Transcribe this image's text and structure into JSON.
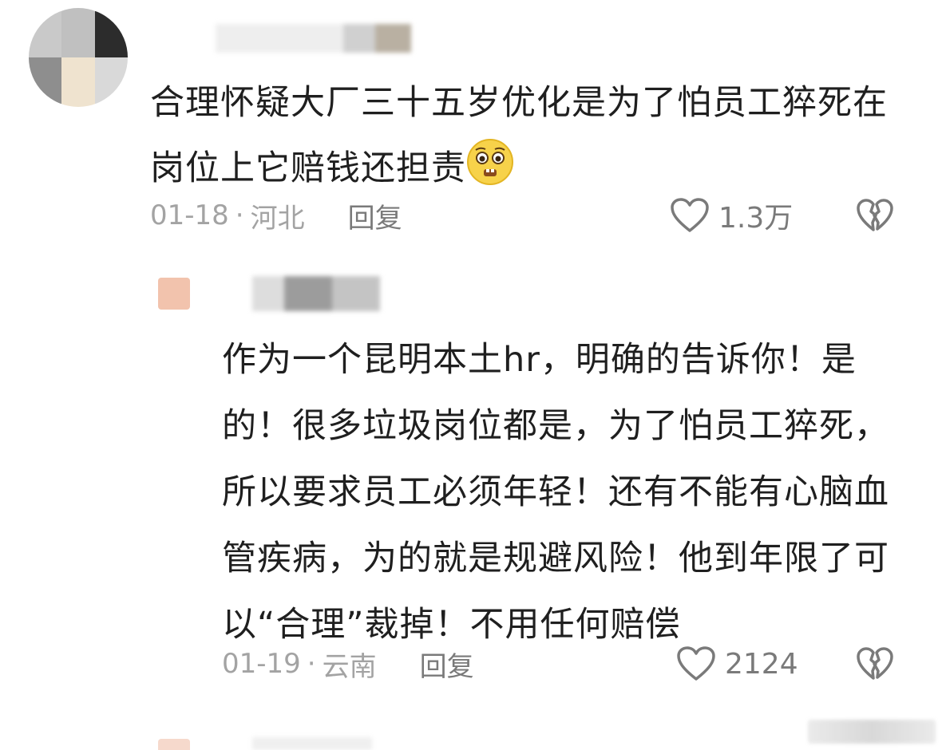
{
  "comments": [
    {
      "text": "合理怀疑大厂三十五岁优化是为了怕员工猝死在岗位上它赔钱还担责",
      "emoji": "pleading-face-emoji",
      "date": "01-18",
      "separator": "·",
      "location": "河北",
      "reply_label": "回复",
      "likes": "1.3万",
      "avatar_colors": [
        "#c9c9c9",
        "#2c2c2c",
        "#8e8e8e",
        "#efe3cf",
        "#d9d9d9",
        "#e8e8e8"
      ],
      "name_colors": [
        "#eeeeee",
        "#d0d0d0",
        "#b9b0a2"
      ]
    },
    {
      "text": "作为一个昆明本土hr，明确的告诉你！是的！很多垃圾岗位都是，为了怕员工猝死，所以要求员工必须年轻！还有不能有心脑血管疾病，为的就是规避风险！他到年限了可以“合理”裁掉！不用任何赔偿",
      "date": "01-19",
      "separator": "·",
      "location": "云南",
      "reply_label": "回复",
      "likes": "2124",
      "avatar_colors": [
        "#f2c3ad"
      ],
      "name_colors": [
        "#dddddd",
        "#9c9c9c",
        "#c4c4c4"
      ]
    }
  ],
  "colors": {
    "text": "#1f1f1f",
    "meta": "#a3a3a3",
    "action": "#7a7a7a"
  }
}
